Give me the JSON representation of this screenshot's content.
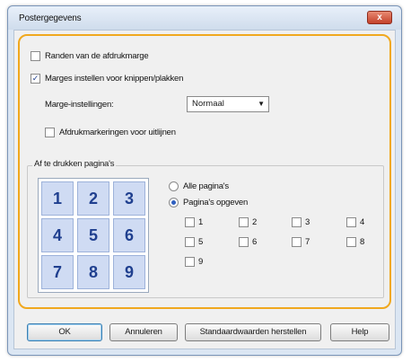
{
  "dialog": {
    "title": "Postergegevens",
    "close_label": "x"
  },
  "options": {
    "margins": {
      "label": "Randen van de afdrukmarge",
      "checked": false
    },
    "cut_paste": {
      "label": "Marges instellen voor knippen/plakken",
      "checked": true
    },
    "margin_settings": {
      "label": "Marge-instellingen:",
      "value": "Normaal"
    },
    "align_marks": {
      "label": "Afdrukmarkeringen voor uitlijnen",
      "checked": false
    }
  },
  "pages_group": {
    "title": "Af te drukken pagina's",
    "grid": [
      "1",
      "2",
      "3",
      "4",
      "5",
      "6",
      "7",
      "8",
      "9"
    ],
    "radio_all": {
      "label": "Alle pagina's",
      "selected": false
    },
    "radio_specify": {
      "label": "Pagina's opgeven",
      "selected": true
    },
    "page_checks": [
      "1",
      "2",
      "3",
      "4",
      "5",
      "6",
      "7",
      "8",
      "9"
    ]
  },
  "buttons": {
    "ok": "OK",
    "cancel": "Annuleren",
    "defaults": "Standaardwaarden herstellen",
    "help": "Help"
  },
  "colors": {
    "accent_frame": "#f0a81e",
    "grid_cell": "#cfdbf3",
    "grid_text": "#1f3f8f"
  }
}
